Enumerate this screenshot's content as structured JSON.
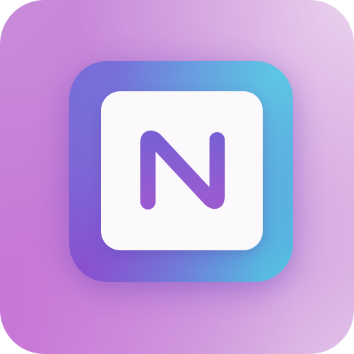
{
  "app_icon": {
    "letter": "N",
    "colors": {
      "background": "#c98ad9",
      "tile_start": "#7a6ad8",
      "tile_end": "#56c2e2",
      "card": "#fbf9fb",
      "letter_top": "#7a5fd4",
      "letter_bottom": "#9b5bd0"
    }
  }
}
